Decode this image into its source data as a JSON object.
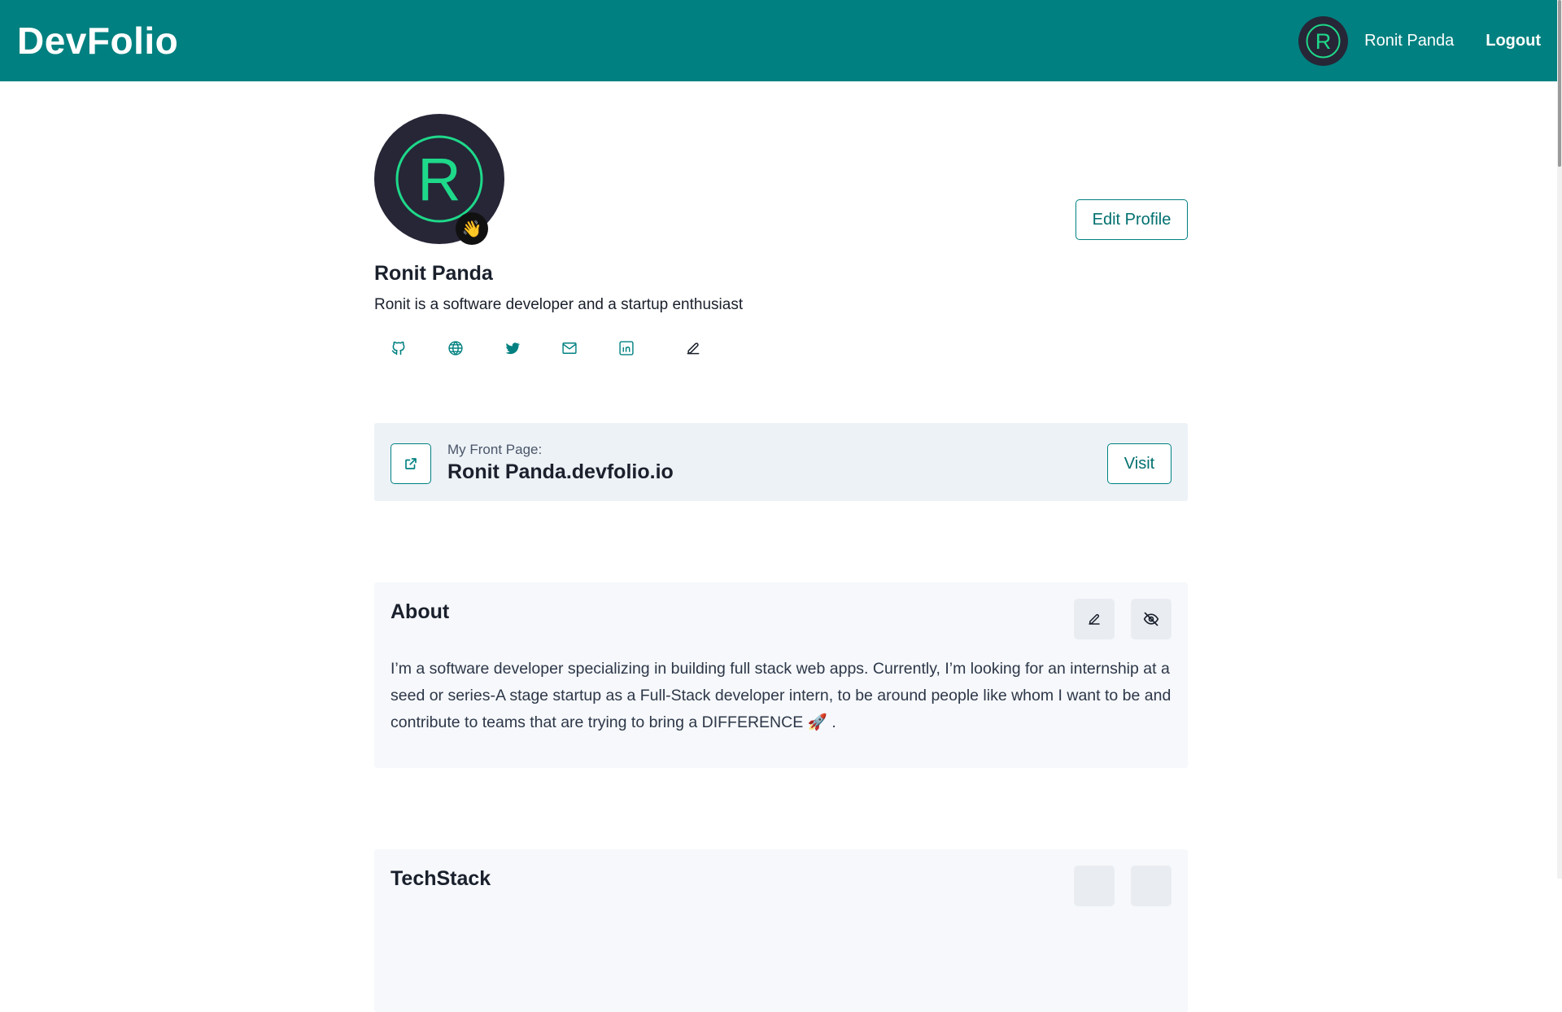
{
  "navbar": {
    "brand": "DevFolio",
    "avatar_letter": "R",
    "user_name": "Ronit Panda",
    "logout_label": "Logout"
  },
  "profile": {
    "avatar_letter": "R",
    "badge_emoji": "👋",
    "name": "Ronit Panda",
    "bio": "Ronit is a software developer and a startup enthusiast",
    "edit_profile_label": "Edit Profile",
    "social_icons": [
      "github-icon",
      "globe-icon",
      "twitter-icon",
      "mail-icon",
      "linkedin-icon",
      "pencil-icon"
    ]
  },
  "front_page": {
    "label": "My Front Page:",
    "url": "Ronit Panda.devfolio.io",
    "visit_label": "Visit"
  },
  "about": {
    "title": "About",
    "text": "I’m a software developer specializing in building full stack web apps. Currently, I’m looking for an internship at a seed or series-A stage startup as a Full-Stack developer intern, to be around people like whom I want to be and contribute to teams that are trying to bring a DIFFERENCE 🚀 ."
  },
  "techstack": {
    "title": "TechStack"
  },
  "colors": {
    "brand_teal": "#008080",
    "avatar_bg": "#262637",
    "avatar_ring": "#1ed98a",
    "card_bg": "#edf2f7",
    "section_bg": "#f6f8fb"
  }
}
